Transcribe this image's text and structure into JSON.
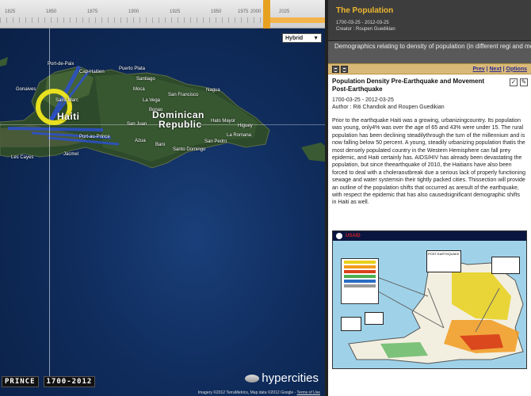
{
  "timeline": {
    "ticks": [
      "1825",
      "1850",
      "1875",
      "1900",
      "1925",
      "1950",
      "1975",
      "2000",
      "2025"
    ]
  },
  "map": {
    "view_select": "Hybrid",
    "labels": {
      "haiti": "Haiti",
      "dominican_republic_1": "Dominican",
      "dominican_republic_2": "Republic",
      "cap_haitien": "Cap-Haitien",
      "port_de_paix": "Port-de-Paix",
      "santiago": "Santiago",
      "puerto_plata": "Puerto Plata",
      "la_vega": "La Vega",
      "san_francisco": "San Francisco",
      "nagua": "Nagua",
      "moca": "Moca",
      "bonao": "Bonao",
      "san_juan": "San Juan",
      "azua": "Azua",
      "bani": "Bani",
      "santo_domingo": "Santo Domingo",
      "san_pedro": "San Pedro",
      "la_romana": "La Romana",
      "higuey": "Higuey",
      "hato_mayor": "Hato Mayor",
      "jacmel": "Jacmel",
      "les_cayes": "Les Cayes",
      "port_au_prince": "Port-au-Prince",
      "saint_marc": "Saint-Marc",
      "gonaives": "Gonaives"
    },
    "bottom": {
      "place": "PRINCE",
      "years": "1700-2012"
    },
    "logo": "hypercities",
    "attribution": "Imagery ©2012 TerraMetrics, Map data ©2012 Google - ",
    "terms": "Terms of Use"
  },
  "panel": {
    "collection_title": "The Population",
    "collection_dates": "1700-03-25 - 2012-03-25",
    "collection_creator": "Creator : Roupen Guedikian",
    "collection_description": "Demographics relating to density of population (in different regi and movement of population over time: rural v. urban",
    "toolbar": {
      "prev": "Prev",
      "next": "Next",
      "options": "Options"
    },
    "item": {
      "title": "Population Density Pre-Earthquake and Movement Post-Earthquake",
      "dates": "1700-03-25 - 2012-03-25",
      "author": "Author : Riti Chandiok and Roupen Guedikian",
      "body": "Prior to the earthquake Haiti was a growing, urbanizingcountry. Its population was young, only4% was over the age of 65 and 43% were under 15. The rural population has been declining steadilythrough the turn of the millennium and is now falling below 50 percent. A young, steadily urbanizing population thatis the most densely populated country in the Western Hemisphere can fall prey epidemic, and Haiti certainly has. AIDS/HIV has already been devastating the population, but since theearthquake of 2010, the Haitians have also been forced to deal with a choleraoutbreak due a serious lack of properly functioning sewage and water systemsin their tightly packed cities. Thissection will provide an outline of the population shifts that occurred as aresult of the earthquake, with respect the epidemic that has also causedsignificant demographic shifts in Haiti as well."
    },
    "figure": {
      "agency": "USAID",
      "caption": "POST-EARTHQUAKE",
      "colors": [
        "#e8d01a",
        "#f29a1e",
        "#d9421b",
        "#4caf50",
        "#2b6cc4"
      ]
    }
  }
}
